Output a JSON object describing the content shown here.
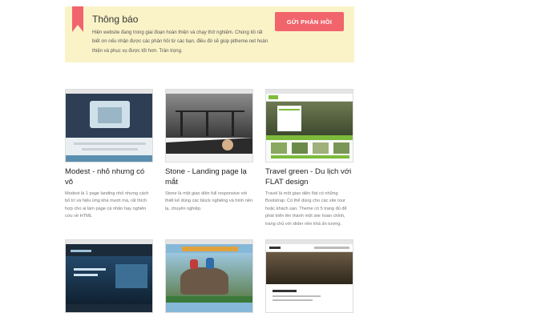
{
  "notice": {
    "title": "Thông báo",
    "body": "Hiện website đang trong giai đoạn hoàn thiện và chạy thử nghiệm. Chúng tôi rất biết ơn nếu nhận được các phản hồi từ các bạn, điều đó sẽ giúp pitheme.net hoàn thiện và phục vụ được tốt hơn. Trân trọng.",
    "button": "GỬI PHẢN HỒI",
    "accent": "#f1646c",
    "background": "#fbf3c8"
  },
  "cards": [
    {
      "title": "Modest - nhỏ nhưng có võ",
      "description": "Modest là 1 page landing nhỏ nhưng cách bố trí và hiệu ứng khá mượt mà, rất thích hợp cho ai làm page cá nhân hay nghiên cứu về HTML"
    },
    {
      "title": "Stone - Landing page lạ mắt",
      "description": "Stone là một giao diện full responsive với thiết kế dùng các block nghiêng và hình nền lạ, chuyên nghiệp."
    },
    {
      "title": "Travel green - Du lịch với FLAT design",
      "description": "Travel là một giao diện flat có những Bootstrap. Có thể dùng cho các site tour hoặc khách sạn. Theme có 5 trang đủ để phát triển lên thành một site hoàn chỉnh, trang chủ với slider nền khá ấn tượng."
    },
    {
      "title": "",
      "description": ""
    },
    {
      "title": "",
      "description": ""
    },
    {
      "title": "",
      "description": ""
    }
  ]
}
